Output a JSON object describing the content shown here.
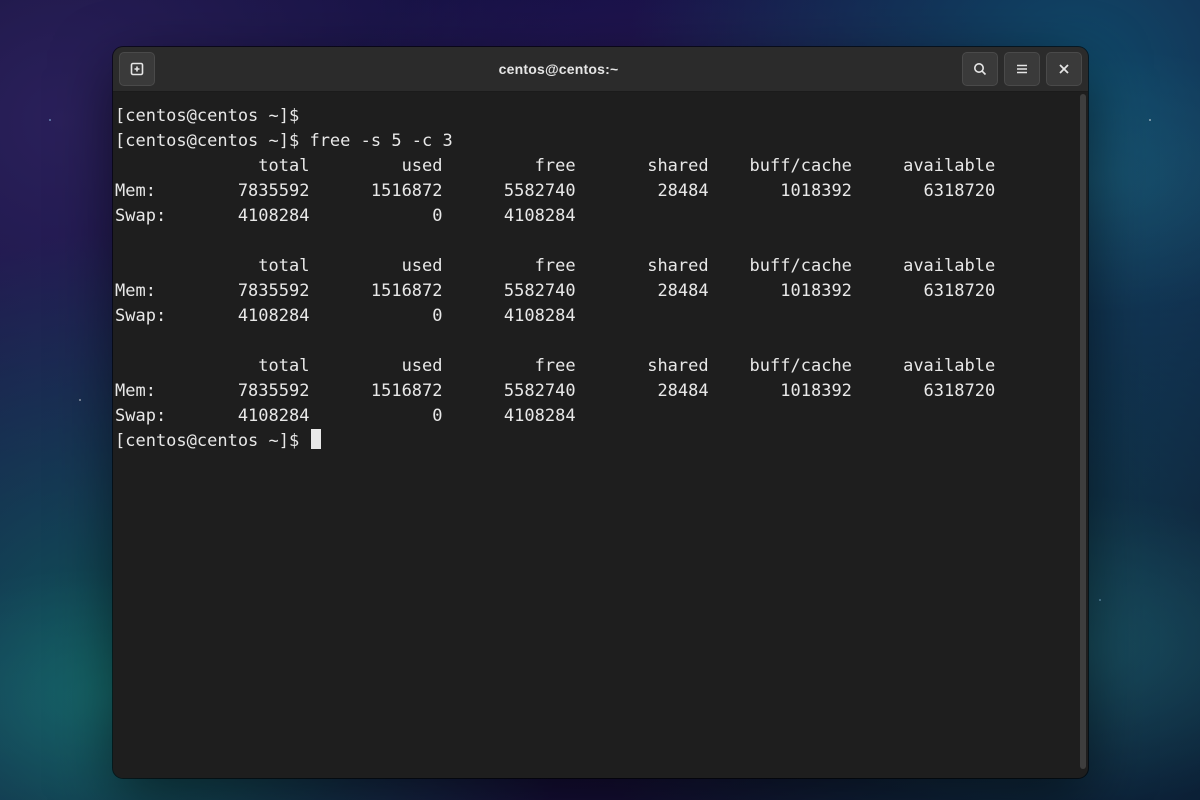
{
  "window": {
    "title": "centos@centos:~"
  },
  "titlebar": {
    "left_button": "new-tab",
    "right_buttons": [
      "search",
      "menu",
      "close"
    ]
  },
  "terminal": {
    "prompt": "[centos@centos ~]$ ",
    "command": "free -s 5 -c 3",
    "headers": [
      "total",
      "used",
      "free",
      "shared",
      "buff/cache",
      "available"
    ],
    "samples": [
      {
        "mem": {
          "label": "Mem:",
          "total": "7835592",
          "used": "1516872",
          "free": "5582740",
          "shared": "28484",
          "buff_cache": "1018392",
          "available": "6318720"
        },
        "swap": {
          "label": "Swap:",
          "total": "4108284",
          "used": "0",
          "free": "4108284"
        }
      },
      {
        "mem": {
          "label": "Mem:",
          "total": "7835592",
          "used": "1516872",
          "free": "5582740",
          "shared": "28484",
          "buff_cache": "1018392",
          "available": "6318720"
        },
        "swap": {
          "label": "Swap:",
          "total": "4108284",
          "used": "0",
          "free": "4108284"
        }
      },
      {
        "mem": {
          "label": "Mem:",
          "total": "7835592",
          "used": "1516872",
          "free": "5582740",
          "shared": "28484",
          "buff_cache": "1018392",
          "available": "6318720"
        },
        "swap": {
          "label": "Swap:",
          "total": "4108284",
          "used": "0",
          "free": "4108284"
        }
      }
    ]
  }
}
